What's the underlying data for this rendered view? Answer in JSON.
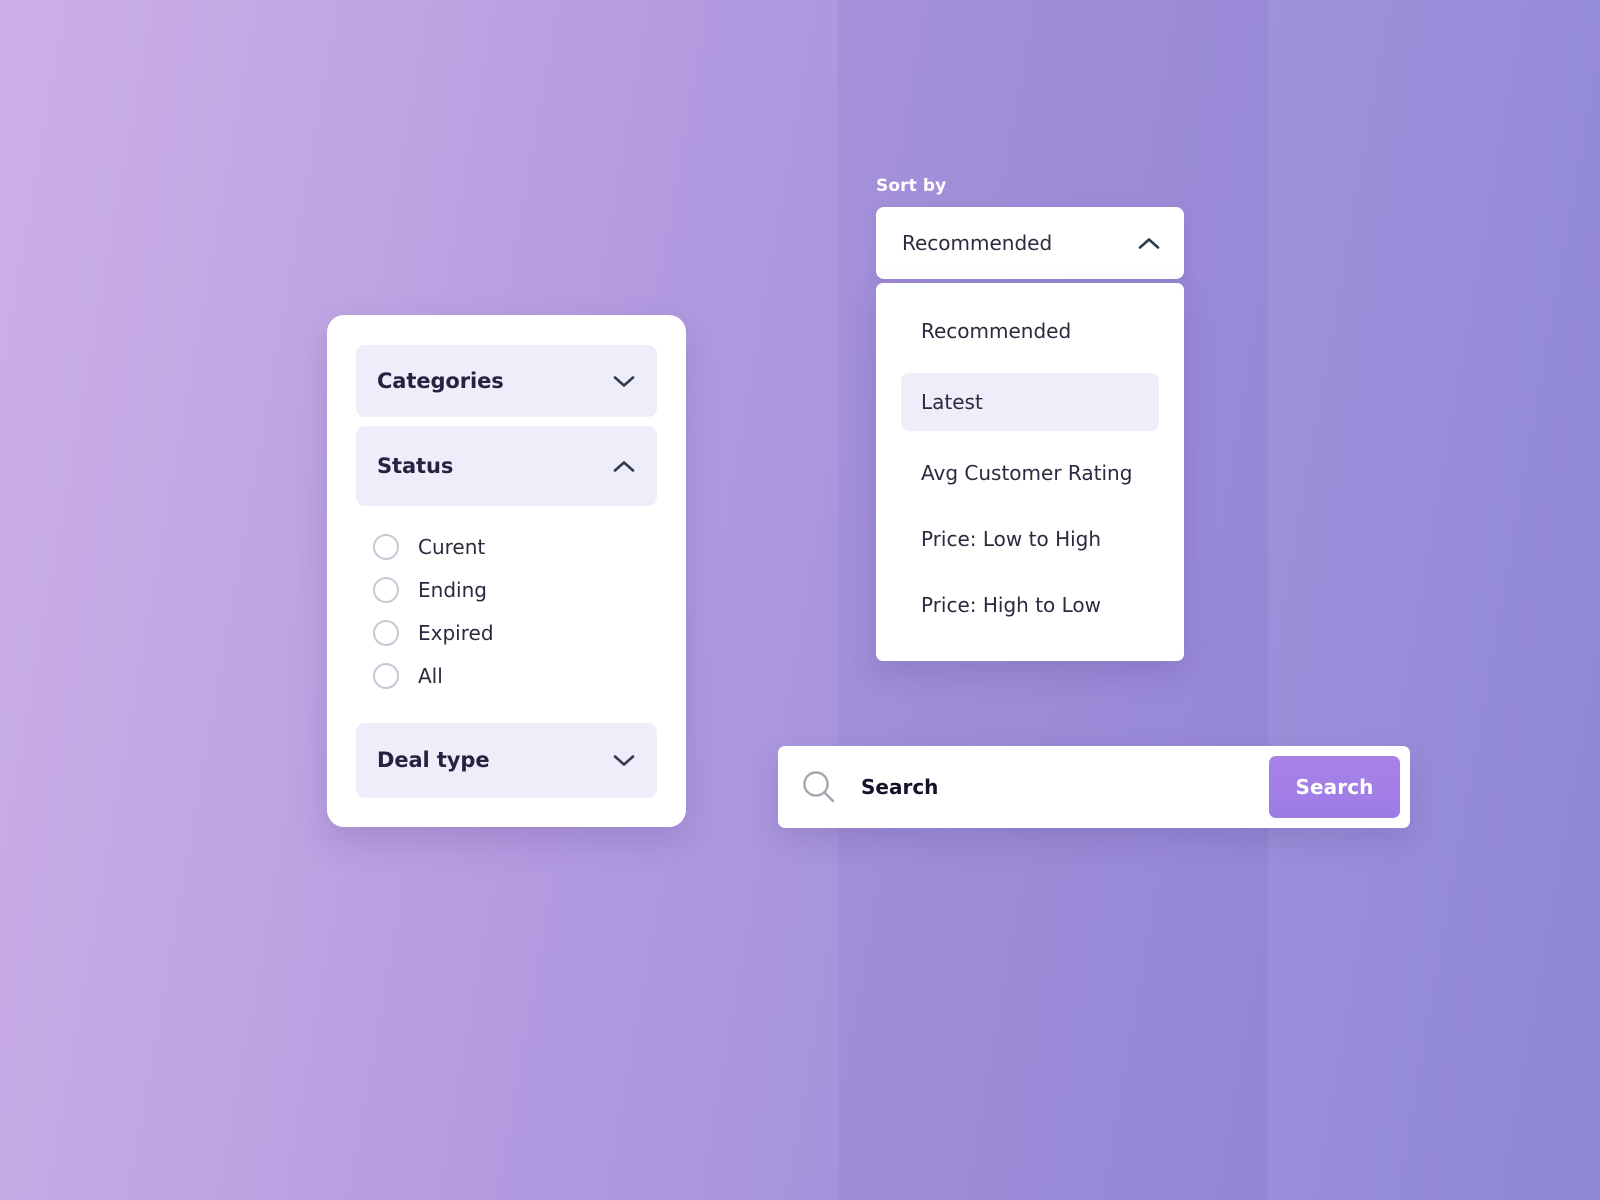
{
  "theme": {
    "bg_gradient_from": "#CDAFE6",
    "bg_gradient_to": "#8E87D6",
    "panel_bg": "#FFFFFF",
    "section_bg": "#EFEDFA",
    "accent": "#9E7AE4",
    "text_dark": "#262341",
    "text_body": "#2B2A3F"
  },
  "filter_panel": {
    "sections": [
      {
        "label": "Categories",
        "icon": "chevron-down-icon",
        "expanded": false
      },
      {
        "label": "Status",
        "icon": "chevron-up-icon",
        "expanded": true
      },
      {
        "label": "Deal type",
        "icon": "chevron-down-icon",
        "expanded": false
      }
    ],
    "status_options": [
      {
        "label": "Curent",
        "selected": false
      },
      {
        "label": "Ending",
        "selected": false
      },
      {
        "label": "Expired",
        "selected": false
      },
      {
        "label": "All",
        "selected": false
      }
    ]
  },
  "sort": {
    "label": "Sort by",
    "selected_value": "Recommended",
    "toggle_icon": "chevron-up-icon",
    "expanded": true,
    "options": [
      {
        "label": "Recommended",
        "highlighted": false
      },
      {
        "label": "Latest",
        "highlighted": true
      },
      {
        "label": "Avg Customer Rating",
        "highlighted": false
      },
      {
        "label": "Price: Low to High",
        "highlighted": false
      },
      {
        "label": "Price: High to Low",
        "highlighted": false
      }
    ]
  },
  "search": {
    "icon": "search-icon",
    "value": "",
    "placeholder": "Search",
    "button_label": "Search"
  }
}
